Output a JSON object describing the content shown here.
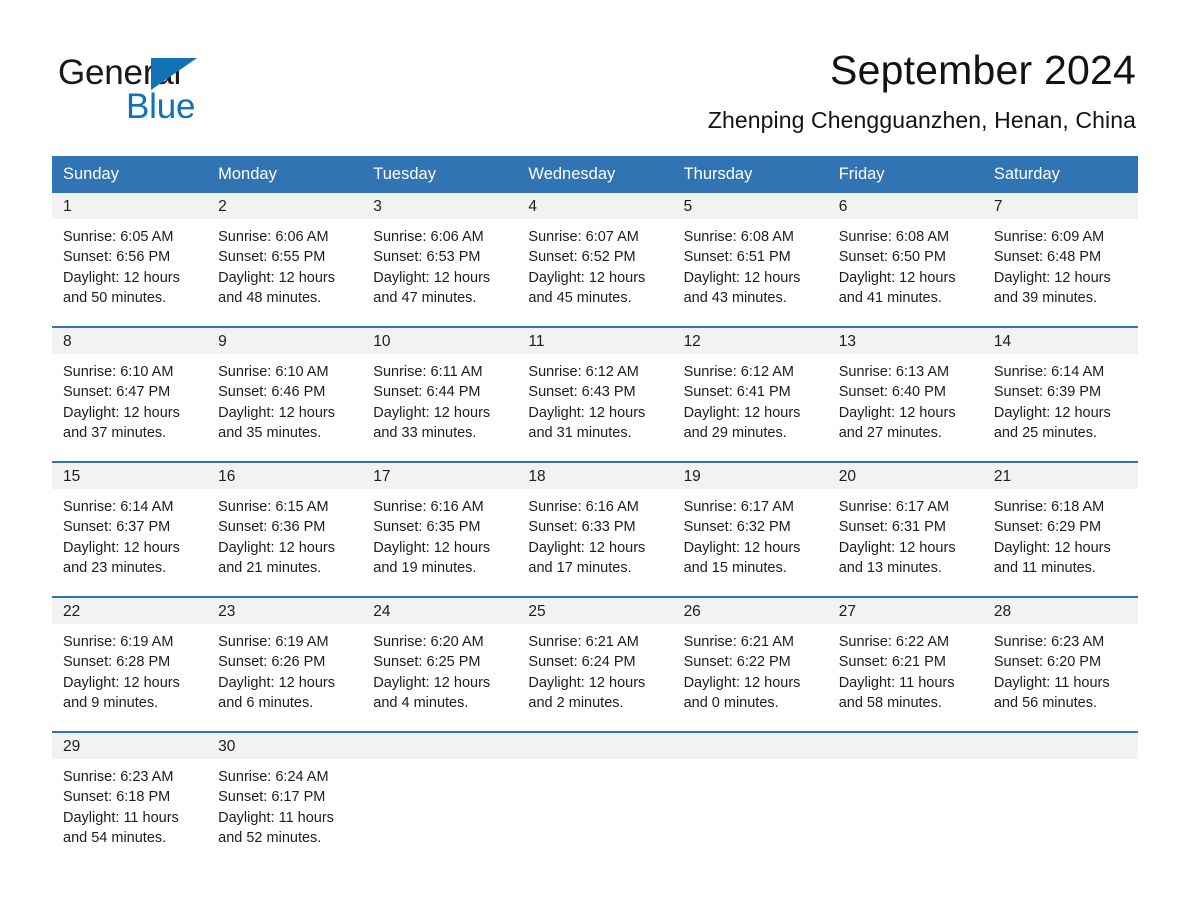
{
  "brand": {
    "name_part1": "General",
    "name_part2": "Blue",
    "accent_color": "#1272b6",
    "triangle_icon": "brand-triangle-icon"
  },
  "header": {
    "month_title": "September 2024",
    "location": "Zhenping Chengguanzhen, Henan, China"
  },
  "calendar": {
    "header_color": "#3074b4",
    "weekdays": [
      "Sunday",
      "Monday",
      "Tuesday",
      "Wednesday",
      "Thursday",
      "Friday",
      "Saturday"
    ],
    "weeks": [
      [
        {
          "day": "1",
          "sunrise": "Sunrise: 6:05 AM",
          "sunset": "Sunset: 6:56 PM",
          "daylight_line1": "Daylight: 12 hours",
          "daylight_line2": "and 50 minutes."
        },
        {
          "day": "2",
          "sunrise": "Sunrise: 6:06 AM",
          "sunset": "Sunset: 6:55 PM",
          "daylight_line1": "Daylight: 12 hours",
          "daylight_line2": "and 48 minutes."
        },
        {
          "day": "3",
          "sunrise": "Sunrise: 6:06 AM",
          "sunset": "Sunset: 6:53 PM",
          "daylight_line1": "Daylight: 12 hours",
          "daylight_line2": "and 47 minutes."
        },
        {
          "day": "4",
          "sunrise": "Sunrise: 6:07 AM",
          "sunset": "Sunset: 6:52 PM",
          "daylight_line1": "Daylight: 12 hours",
          "daylight_line2": "and 45 minutes."
        },
        {
          "day": "5",
          "sunrise": "Sunrise: 6:08 AM",
          "sunset": "Sunset: 6:51 PM",
          "daylight_line1": "Daylight: 12 hours",
          "daylight_line2": "and 43 minutes."
        },
        {
          "day": "6",
          "sunrise": "Sunrise: 6:08 AM",
          "sunset": "Sunset: 6:50 PM",
          "daylight_line1": "Daylight: 12 hours",
          "daylight_line2": "and 41 minutes."
        },
        {
          "day": "7",
          "sunrise": "Sunrise: 6:09 AM",
          "sunset": "Sunset: 6:48 PM",
          "daylight_line1": "Daylight: 12 hours",
          "daylight_line2": "and 39 minutes."
        }
      ],
      [
        {
          "day": "8",
          "sunrise": "Sunrise: 6:10 AM",
          "sunset": "Sunset: 6:47 PM",
          "daylight_line1": "Daylight: 12 hours",
          "daylight_line2": "and 37 minutes."
        },
        {
          "day": "9",
          "sunrise": "Sunrise: 6:10 AM",
          "sunset": "Sunset: 6:46 PM",
          "daylight_line1": "Daylight: 12 hours",
          "daylight_line2": "and 35 minutes."
        },
        {
          "day": "10",
          "sunrise": "Sunrise: 6:11 AM",
          "sunset": "Sunset: 6:44 PM",
          "daylight_line1": "Daylight: 12 hours",
          "daylight_line2": "and 33 minutes."
        },
        {
          "day": "11",
          "sunrise": "Sunrise: 6:12 AM",
          "sunset": "Sunset: 6:43 PM",
          "daylight_line1": "Daylight: 12 hours",
          "daylight_line2": "and 31 minutes."
        },
        {
          "day": "12",
          "sunrise": "Sunrise: 6:12 AM",
          "sunset": "Sunset: 6:41 PM",
          "daylight_line1": "Daylight: 12 hours",
          "daylight_line2": "and 29 minutes."
        },
        {
          "day": "13",
          "sunrise": "Sunrise: 6:13 AM",
          "sunset": "Sunset: 6:40 PM",
          "daylight_line1": "Daylight: 12 hours",
          "daylight_line2": "and 27 minutes."
        },
        {
          "day": "14",
          "sunrise": "Sunrise: 6:14 AM",
          "sunset": "Sunset: 6:39 PM",
          "daylight_line1": "Daylight: 12 hours",
          "daylight_line2": "and 25 minutes."
        }
      ],
      [
        {
          "day": "15",
          "sunrise": "Sunrise: 6:14 AM",
          "sunset": "Sunset: 6:37 PM",
          "daylight_line1": "Daylight: 12 hours",
          "daylight_line2": "and 23 minutes."
        },
        {
          "day": "16",
          "sunrise": "Sunrise: 6:15 AM",
          "sunset": "Sunset: 6:36 PM",
          "daylight_line1": "Daylight: 12 hours",
          "daylight_line2": "and 21 minutes."
        },
        {
          "day": "17",
          "sunrise": "Sunrise: 6:16 AM",
          "sunset": "Sunset: 6:35 PM",
          "daylight_line1": "Daylight: 12 hours",
          "daylight_line2": "and 19 minutes."
        },
        {
          "day": "18",
          "sunrise": "Sunrise: 6:16 AM",
          "sunset": "Sunset: 6:33 PM",
          "daylight_line1": "Daylight: 12 hours",
          "daylight_line2": "and 17 minutes."
        },
        {
          "day": "19",
          "sunrise": "Sunrise: 6:17 AM",
          "sunset": "Sunset: 6:32 PM",
          "daylight_line1": "Daylight: 12 hours",
          "daylight_line2": "and 15 minutes."
        },
        {
          "day": "20",
          "sunrise": "Sunrise: 6:17 AM",
          "sunset": "Sunset: 6:31 PM",
          "daylight_line1": "Daylight: 12 hours",
          "daylight_line2": "and 13 minutes."
        },
        {
          "day": "21",
          "sunrise": "Sunrise: 6:18 AM",
          "sunset": "Sunset: 6:29 PM",
          "daylight_line1": "Daylight: 12 hours",
          "daylight_line2": "and 11 minutes."
        }
      ],
      [
        {
          "day": "22",
          "sunrise": "Sunrise: 6:19 AM",
          "sunset": "Sunset: 6:28 PM",
          "daylight_line1": "Daylight: 12 hours",
          "daylight_line2": "and 9 minutes."
        },
        {
          "day": "23",
          "sunrise": "Sunrise: 6:19 AM",
          "sunset": "Sunset: 6:26 PM",
          "daylight_line1": "Daylight: 12 hours",
          "daylight_line2": "and 6 minutes."
        },
        {
          "day": "24",
          "sunrise": "Sunrise: 6:20 AM",
          "sunset": "Sunset: 6:25 PM",
          "daylight_line1": "Daylight: 12 hours",
          "daylight_line2": "and 4 minutes."
        },
        {
          "day": "25",
          "sunrise": "Sunrise: 6:21 AM",
          "sunset": "Sunset: 6:24 PM",
          "daylight_line1": "Daylight: 12 hours",
          "daylight_line2": "and 2 minutes."
        },
        {
          "day": "26",
          "sunrise": "Sunrise: 6:21 AM",
          "sunset": "Sunset: 6:22 PM",
          "daylight_line1": "Daylight: 12 hours",
          "daylight_line2": "and 0 minutes."
        },
        {
          "day": "27",
          "sunrise": "Sunrise: 6:22 AM",
          "sunset": "Sunset: 6:21 PM",
          "daylight_line1": "Daylight: 11 hours",
          "daylight_line2": "and 58 minutes."
        },
        {
          "day": "28",
          "sunrise": "Sunrise: 6:23 AM",
          "sunset": "Sunset: 6:20 PM",
          "daylight_line1": "Daylight: 11 hours",
          "daylight_line2": "and 56 minutes."
        }
      ],
      [
        {
          "day": "29",
          "sunrise": "Sunrise: 6:23 AM",
          "sunset": "Sunset: 6:18 PM",
          "daylight_line1": "Daylight: 11 hours",
          "daylight_line2": "and 54 minutes."
        },
        {
          "day": "30",
          "sunrise": "Sunrise: 6:24 AM",
          "sunset": "Sunset: 6:17 PM",
          "daylight_line1": "Daylight: 11 hours",
          "daylight_line2": "and 52 minutes."
        },
        {
          "day": "",
          "sunrise": "",
          "sunset": "",
          "daylight_line1": "",
          "daylight_line2": ""
        },
        {
          "day": "",
          "sunrise": "",
          "sunset": "",
          "daylight_line1": "",
          "daylight_line2": ""
        },
        {
          "day": "",
          "sunrise": "",
          "sunset": "",
          "daylight_line1": "",
          "daylight_line2": ""
        },
        {
          "day": "",
          "sunrise": "",
          "sunset": "",
          "daylight_line1": "",
          "daylight_line2": ""
        },
        {
          "day": "",
          "sunrise": "",
          "sunset": "",
          "daylight_line1": "",
          "daylight_line2": ""
        }
      ]
    ]
  }
}
